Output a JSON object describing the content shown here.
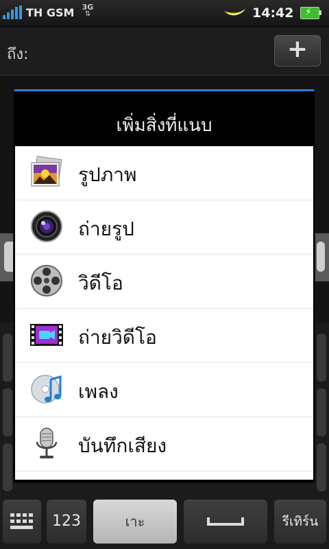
{
  "status_bar": {
    "carrier": "TH GSM",
    "network_top": "3G",
    "network_bottom": "⇅",
    "time": "14:42"
  },
  "compose": {
    "to_label": "ถึง:",
    "add_button": "+"
  },
  "dialog": {
    "title": "เพิ่มสิ่งที่แนบ",
    "items": [
      {
        "label": "รูปภาพ",
        "icon": "gallery-icon"
      },
      {
        "label": "ถ่ายรูป",
        "icon": "camera-icon"
      },
      {
        "label": "วิดีโอ",
        "icon": "video-reel-icon"
      },
      {
        "label": "ถ่ายวิดีโอ",
        "icon": "video-capture-icon"
      },
      {
        "label": "เพลง",
        "icon": "music-icon"
      },
      {
        "label": "บันทึกเสียง",
        "icon": "microphone-icon"
      }
    ]
  },
  "keyboard": {
    "key_123": "123",
    "key_letter": "เาะ",
    "key_return": "รีเทิร์น"
  },
  "colors": {
    "accent": "#2e7fd6",
    "battery": "#3bbf2b",
    "signal": "#2f9be0"
  }
}
